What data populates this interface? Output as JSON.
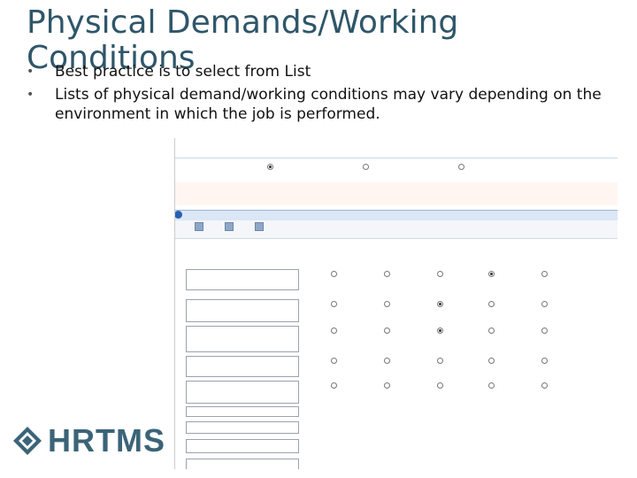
{
  "slide": {
    "title": "Physical Demands/Working Conditions",
    "bullets": [
      "Best practice is to select from List",
      "Lists of physical demand/working conditions may vary depending on the environment in which the job is performed."
    ]
  },
  "logo": {
    "text": "HRTMS",
    "color": "#3b6478"
  },
  "colors": {
    "title": "#2f5669",
    "accent": "#2b5fb0"
  }
}
